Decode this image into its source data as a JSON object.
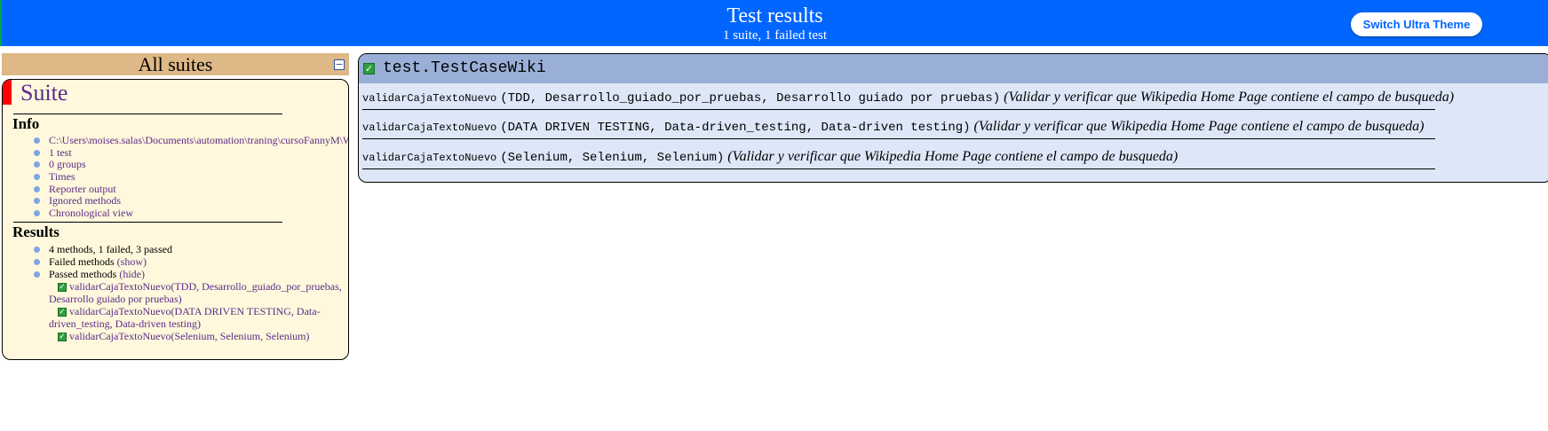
{
  "banner": {
    "title": "Test results",
    "subtitle": "1 suite, 1 failed test",
    "theme_button": "Switch Ultra Theme"
  },
  "navigator": {
    "header": "All suites",
    "collapse_symbol": "−",
    "suite_title": "Suite",
    "info": {
      "heading": "Info",
      "items": [
        "C:\\Users\\moises.salas\\Documents\\automation\\traning\\cursoFannyM\\Wiki",
        "1 test",
        "0 groups",
        "Times",
        "Reporter output",
        "Ignored methods",
        "Chronological view"
      ]
    },
    "results": {
      "heading": "Results",
      "summary": "4 methods, 1 failed, 3 passed",
      "failed_label": "Failed methods",
      "failed_toggle": "(show)",
      "passed_label": "Passed methods",
      "passed_toggle": "(hide)",
      "passed_methods": [
        [
          "validarCajaTextoNuevo(TDD, Desarrollo_guiado_por_pruebas,",
          "Desarrollo guiado por pruebas)"
        ],
        [
          "validarCajaTextoNuevo(DATA DRIVEN TESTING, Data-",
          "driven_testing, Data-driven testing)"
        ],
        [
          "validarCajaTextoNuevo(Selenium, Selenium, Selenium)"
        ]
      ]
    }
  },
  "test_panel": {
    "name": "test.TestCaseWiki",
    "status_icon": "passed-check-icon",
    "methods": [
      {
        "name": "validarCajaTextoNuevo",
        "params": "(TDD, Desarrollo_guiado_por_pruebas, Desarrollo guiado por pruebas)",
        "description": "(Validar y verificar que Wikipedia Home Page contiene el campo de busqueda)"
      },
      {
        "name": "validarCajaTextoNuevo",
        "params": "(DATA DRIVEN TESTING, Data-driven_testing, Data-driven testing)",
        "description": "(Validar y verificar que Wikipedia Home Page contiene el campo de busqueda)"
      },
      {
        "name": "validarCajaTextoNuevo",
        "params": "(Selenium, Selenium, Selenium)",
        "description": "(Validar y verificar que Wikipedia Home Page contiene el campo de busqueda)"
      }
    ]
  },
  "colors": {
    "banner": "#0066ff",
    "nav_header": "#deb887",
    "suite_bg": "#fff8dc",
    "suite_failed": "#ff0000",
    "test_panel_bg": "#dde7f8",
    "test_header_bg": "#9aafd8",
    "passed_check": "#2e9e3e",
    "link": "#5b2c8a"
  }
}
